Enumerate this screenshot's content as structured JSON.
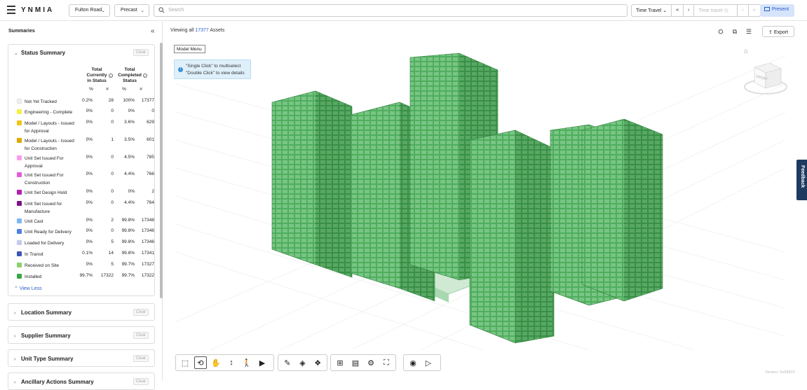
{
  "header": {
    "logo": "YNMIA",
    "project": "Fulton Road",
    "discipline": "Precast",
    "search_placeholder": "Search",
    "time_travel_label": "Time Travel",
    "time_travel_input_placeholder": "Time travel",
    "present_label": "Present"
  },
  "sidebar": {
    "title": "Summaries",
    "status_card": {
      "title": "Status Summary",
      "clear": "Clear",
      "col_currently": "Total Currently in Status",
      "col_completed": "Total Completed Status",
      "pct": "%",
      "num": "#",
      "rows": [
        {
          "label": "Not Yet Tracked",
          "color": "#f0f0f0",
          "cur_pct": "0.2%",
          "cur_num": "28",
          "comp_pct": "100%",
          "comp_num": "17377"
        },
        {
          "label": "Engineering - Complete",
          "color": "#f5f04a",
          "cur_pct": "0%",
          "cur_num": "0",
          "comp_pct": "0%",
          "comp_num": "0"
        },
        {
          "label": "Model / Layouts - Issued for Approval",
          "color": "#f0c419",
          "cur_pct": "0%",
          "cur_num": "0",
          "comp_pct": "3.6%",
          "comp_num": "629"
        },
        {
          "label": "Model / Layouts - Issued for Construction",
          "color": "#e0a800",
          "cur_pct": "0%",
          "cur_num": "1",
          "comp_pct": "3.5%",
          "comp_num": "601"
        },
        {
          "label": "Unit Set Issued For Approval",
          "color": "#f79cf0",
          "cur_pct": "0%",
          "cur_num": "0",
          "comp_pct": "4.5%",
          "comp_num": "785"
        },
        {
          "label": "Unit Set Issued For Construction",
          "color": "#e65ad8",
          "cur_pct": "0%",
          "cur_num": "0",
          "comp_pct": "4.4%",
          "comp_num": "766"
        },
        {
          "label": "Unit Set Design Hold",
          "color": "#b31fb0",
          "cur_pct": "0%",
          "cur_num": "0",
          "comp_pct": "0%",
          "comp_num": "2"
        },
        {
          "label": "Unit Set Issued for Manufacture",
          "color": "#7a1387",
          "cur_pct": "0%",
          "cur_num": "0",
          "comp_pct": "4.4%",
          "comp_num": "764"
        },
        {
          "label": "Unit Cast",
          "color": "#7eb6f2",
          "cur_pct": "0%",
          "cur_num": "2",
          "comp_pct": "99.8%",
          "comp_num": "17348"
        },
        {
          "label": "Unit Ready for Delivery",
          "color": "#4e7fe0",
          "cur_pct": "0%",
          "cur_num": "0",
          "comp_pct": "99.8%",
          "comp_num": "17346"
        },
        {
          "label": "Loaded for Delivery",
          "color": "#c6c9ee",
          "cur_pct": "0%",
          "cur_num": "5",
          "comp_pct": "99.8%",
          "comp_num": "17346"
        },
        {
          "label": "In Transit",
          "color": "#3d55b5",
          "cur_pct": "0.1%",
          "cur_num": "14",
          "comp_pct": "99.8%",
          "comp_num": "17341"
        },
        {
          "label": "Received on Site",
          "color": "#8bd06a",
          "cur_pct": "0%",
          "cur_num": "5",
          "comp_pct": "99.7%",
          "comp_num": "17327"
        },
        {
          "label": "Installed",
          "color": "#3aa64a",
          "cur_pct": "99.7%",
          "cur_num": "17322",
          "comp_pct": "99.7%",
          "comp_num": "17322"
        }
      ],
      "view_less": "View Less"
    },
    "collapsed_cards": [
      {
        "title": "Location Summary",
        "clear": "Clear"
      },
      {
        "title": "Supplier Summary",
        "clear": "Clear"
      },
      {
        "title": "Unit Type Summary",
        "clear": "Clear"
      },
      {
        "title": "Ancillary Actions Summary",
        "clear": "Clear"
      }
    ]
  },
  "main": {
    "viewing_prefix": "Viewing all",
    "viewing_count": "17377",
    "viewing_suffix": "Assets",
    "export_label": "Export",
    "model_menu": "Model Menu",
    "tip_line1": "\"Single Click\" to multiselect",
    "tip_line2": "\"Double Click\" to view details",
    "feedback": "Feedback",
    "version": "Version: 5e58822",
    "cube_face": "FRONT"
  },
  "colors": {
    "accent": "#2a5dc9",
    "model_green": "#3f9e4f"
  }
}
